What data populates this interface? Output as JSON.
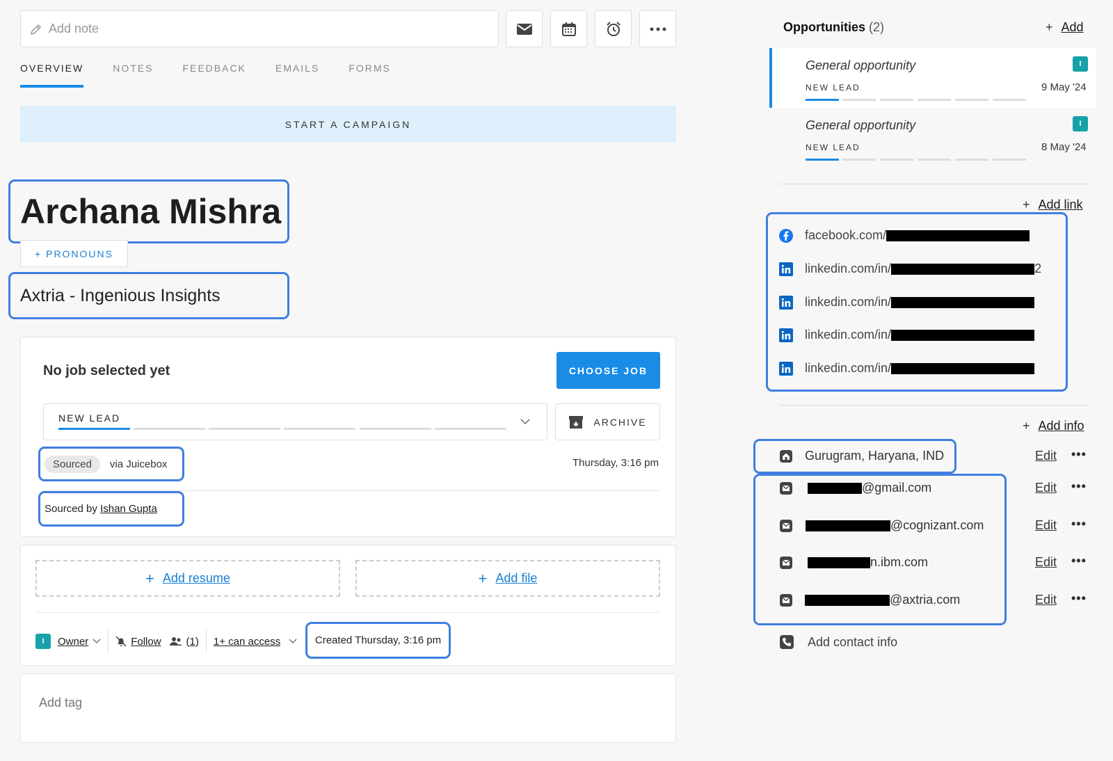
{
  "note": {
    "placeholder": "Add note"
  },
  "toolbar": {
    "email_icon": "envelope-icon",
    "calendar_icon": "calendar-icon",
    "alarm_icon": "alarm-clock-icon",
    "more_icon": "more-icon"
  },
  "tabs": [
    {
      "label": "OVERVIEW",
      "active": true
    },
    {
      "label": "NOTES",
      "active": false
    },
    {
      "label": "FEEDBACK",
      "active": false
    },
    {
      "label": "EMAILS",
      "active": false
    },
    {
      "label": "FORMS",
      "active": false
    }
  ],
  "campaign_button": "START A CAMPAIGN",
  "profile": {
    "name": "Archana Mishra",
    "pronouns_button": "+ PRONOUNS",
    "company": "Axtria - Ingenious Insights"
  },
  "job": {
    "title": "No job selected yet",
    "choose_button": "CHOOSE JOB",
    "stage": "NEW LEAD",
    "archive_button": "ARCHIVE",
    "source_pill": "Sourced",
    "source_via": "via Juicebox",
    "source_time": "Thursday, 3:16 pm",
    "sourced_by_prefix": "Sourced by",
    "sourced_by_name": "Ishan Gupta"
  },
  "files": {
    "add_resume": "Add resume",
    "add_file": "Add file"
  },
  "meta": {
    "owner_badge": "I",
    "owner": "Owner",
    "follow": "Follow",
    "followers": "(1)",
    "access": "1+ can access",
    "created": "Created Thursday, 3:16 pm"
  },
  "tags": {
    "placeholder": "Add tag"
  },
  "opportunities": {
    "title": "Opportunities",
    "count": "(2)",
    "add": "Add",
    "items": [
      {
        "name": "General opportunity",
        "stage": "NEW LEAD",
        "date": "9 May '24",
        "badge": "I"
      },
      {
        "name": "General opportunity",
        "stage": "NEW LEAD",
        "date": "8 May '24",
        "badge": "I"
      }
    ]
  },
  "links": {
    "add": "Add link",
    "items": [
      {
        "prefix": "facebook.com/",
        "suffix": "",
        "icon": "facebook-icon"
      },
      {
        "prefix": "linkedin.com/in/",
        "suffix": "2",
        "icon": "linkedin-icon"
      },
      {
        "prefix": "linkedin.com/in/",
        "suffix": "",
        "icon": "linkedin-icon"
      },
      {
        "prefix": "linkedin.com/in/",
        "suffix": "",
        "icon": "linkedin-icon"
      },
      {
        "prefix": "linkedin.com/in/",
        "suffix": "",
        "icon": "linkedin-icon"
      }
    ]
  },
  "info": {
    "add": "Add info",
    "location": "Gurugram, Haryana, IND",
    "edit_label": "Edit",
    "emails": [
      {
        "suffix": "@gmail.com"
      },
      {
        "suffix": "@cognizant.com"
      },
      {
        "suffix": "n.ibm.com"
      },
      {
        "suffix": "@axtria.com"
      }
    ],
    "add_contact": "Add contact info"
  }
}
